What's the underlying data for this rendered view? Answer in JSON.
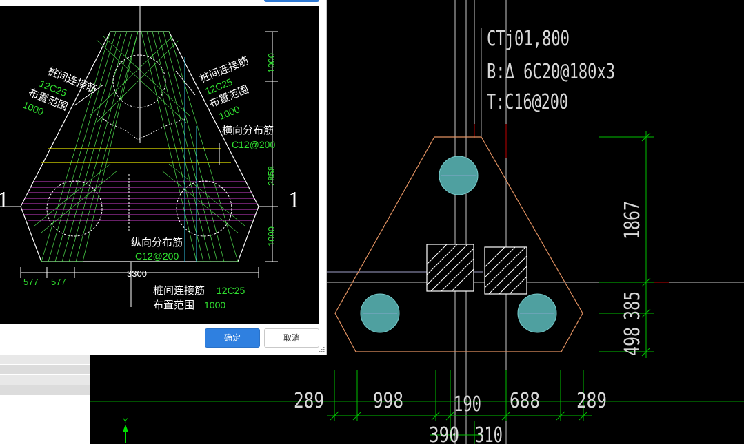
{
  "colors": {
    "background": "#000000",
    "green_dim": "#00c000",
    "orange_outline": "#e09060",
    "pile_fill": "#4fa0a0",
    "primary_button": "#2f80e0",
    "magenta": "#d040d0",
    "yellow": "#e0e000"
  },
  "dialog": {
    "ok_label": "确定",
    "cancel_label": "取消",
    "preview": {
      "section_mark_left": "1",
      "section_mark_right": "1",
      "left_conn_title": "桩间连接筋",
      "left_conn_spec": "12C25",
      "left_range_title": "布置范围",
      "left_range_value": "1000",
      "right_conn_title": "桩间连接筋",
      "right_conn_spec": "12C25",
      "right_range_title": "布置范围",
      "right_range_value": "1000",
      "transverse_title": "横向分布筋",
      "transverse_spec": "C12@200",
      "longitudinal_title": "纵向分布筋",
      "longitudinal_spec": "C12@200",
      "bottom_conn_title": "桩间连接筋",
      "bottom_conn_spec": "12C25",
      "bottom_range_title": "布置范围",
      "bottom_range_value": "1000",
      "dim_right_top": "1000",
      "dim_right_mid": "2858",
      "dim_right_bot": "1000",
      "dim_bottom_1": "577",
      "dim_bottom_2": "577",
      "dim_bottom_total": "3300"
    }
  },
  "drawing": {
    "label_line1": "CTj01,800",
    "label_line2": "B:Δ 6C20@180x3",
    "label_line3": "T:C16@200",
    "dim_vertical_1": "1867",
    "dim_vertical_2": "385",
    "dim_vertical_3": "498",
    "dim_h_1": "289",
    "dim_h_2": "998",
    "dim_h_3": "190",
    "dim_h_4": "688",
    "dim_h_5": "289",
    "dim_h_6": "390",
    "dim_h_7": "310",
    "ucs_axis_label": "Y"
  }
}
